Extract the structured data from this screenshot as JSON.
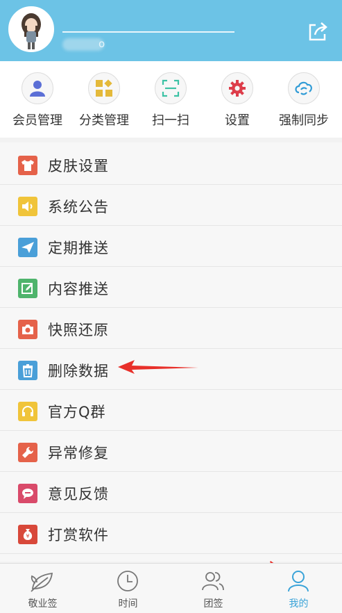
{
  "header": {
    "username_tail": "o",
    "share_icon": "share-icon"
  },
  "quick_actions": [
    {
      "label": "会员管理",
      "icon": "member-icon",
      "color": "#5b6fd6"
    },
    {
      "label": "分类管理",
      "icon": "category-icon",
      "color": "#e4b93a"
    },
    {
      "label": "扫一扫",
      "icon": "scan-icon",
      "color": "#3cc2a5"
    },
    {
      "label": "设置",
      "icon": "gear-icon",
      "color": "#dd3d4a"
    },
    {
      "label": "强制同步",
      "icon": "sync-icon",
      "color": "#2f9bd6"
    }
  ],
  "menu": [
    {
      "label": "皮肤设置",
      "icon": "shirt-icon",
      "color": "#e5624a"
    },
    {
      "label": "系统公告",
      "icon": "speaker-icon",
      "color": "#f0c43a"
    },
    {
      "label": "定期推送",
      "icon": "paper-plane-icon",
      "color": "#4a9fd8"
    },
    {
      "label": "内容推送",
      "icon": "edit-icon",
      "color": "#4fb46c"
    },
    {
      "label": "快照还原",
      "icon": "camera-icon",
      "color": "#e5624a"
    },
    {
      "label": "删除数据",
      "icon": "trash-icon",
      "color": "#4a9fd8"
    },
    {
      "label": "官方Q群",
      "icon": "headset-icon",
      "color": "#f0c43a"
    },
    {
      "label": "异常修复",
      "icon": "wrench-icon",
      "color": "#e5624a"
    },
    {
      "label": "意见反馈",
      "icon": "chat-icon",
      "color": "#d94a6a"
    },
    {
      "label": "打赏软件",
      "icon": "money-bag-icon",
      "color": "#d8483a"
    }
  ],
  "tabs": [
    {
      "label": "敬业签",
      "icon": "leaf-icon",
      "active": false
    },
    {
      "label": "时间",
      "icon": "clock-icon",
      "active": false
    },
    {
      "label": "团签",
      "icon": "group-icon",
      "active": false
    },
    {
      "label": "我的",
      "icon": "person-icon",
      "active": true
    }
  ],
  "colors": {
    "header": "#6cc3e6",
    "accent": "#3aa3d8",
    "annotation_arrow": "#e8302a"
  }
}
